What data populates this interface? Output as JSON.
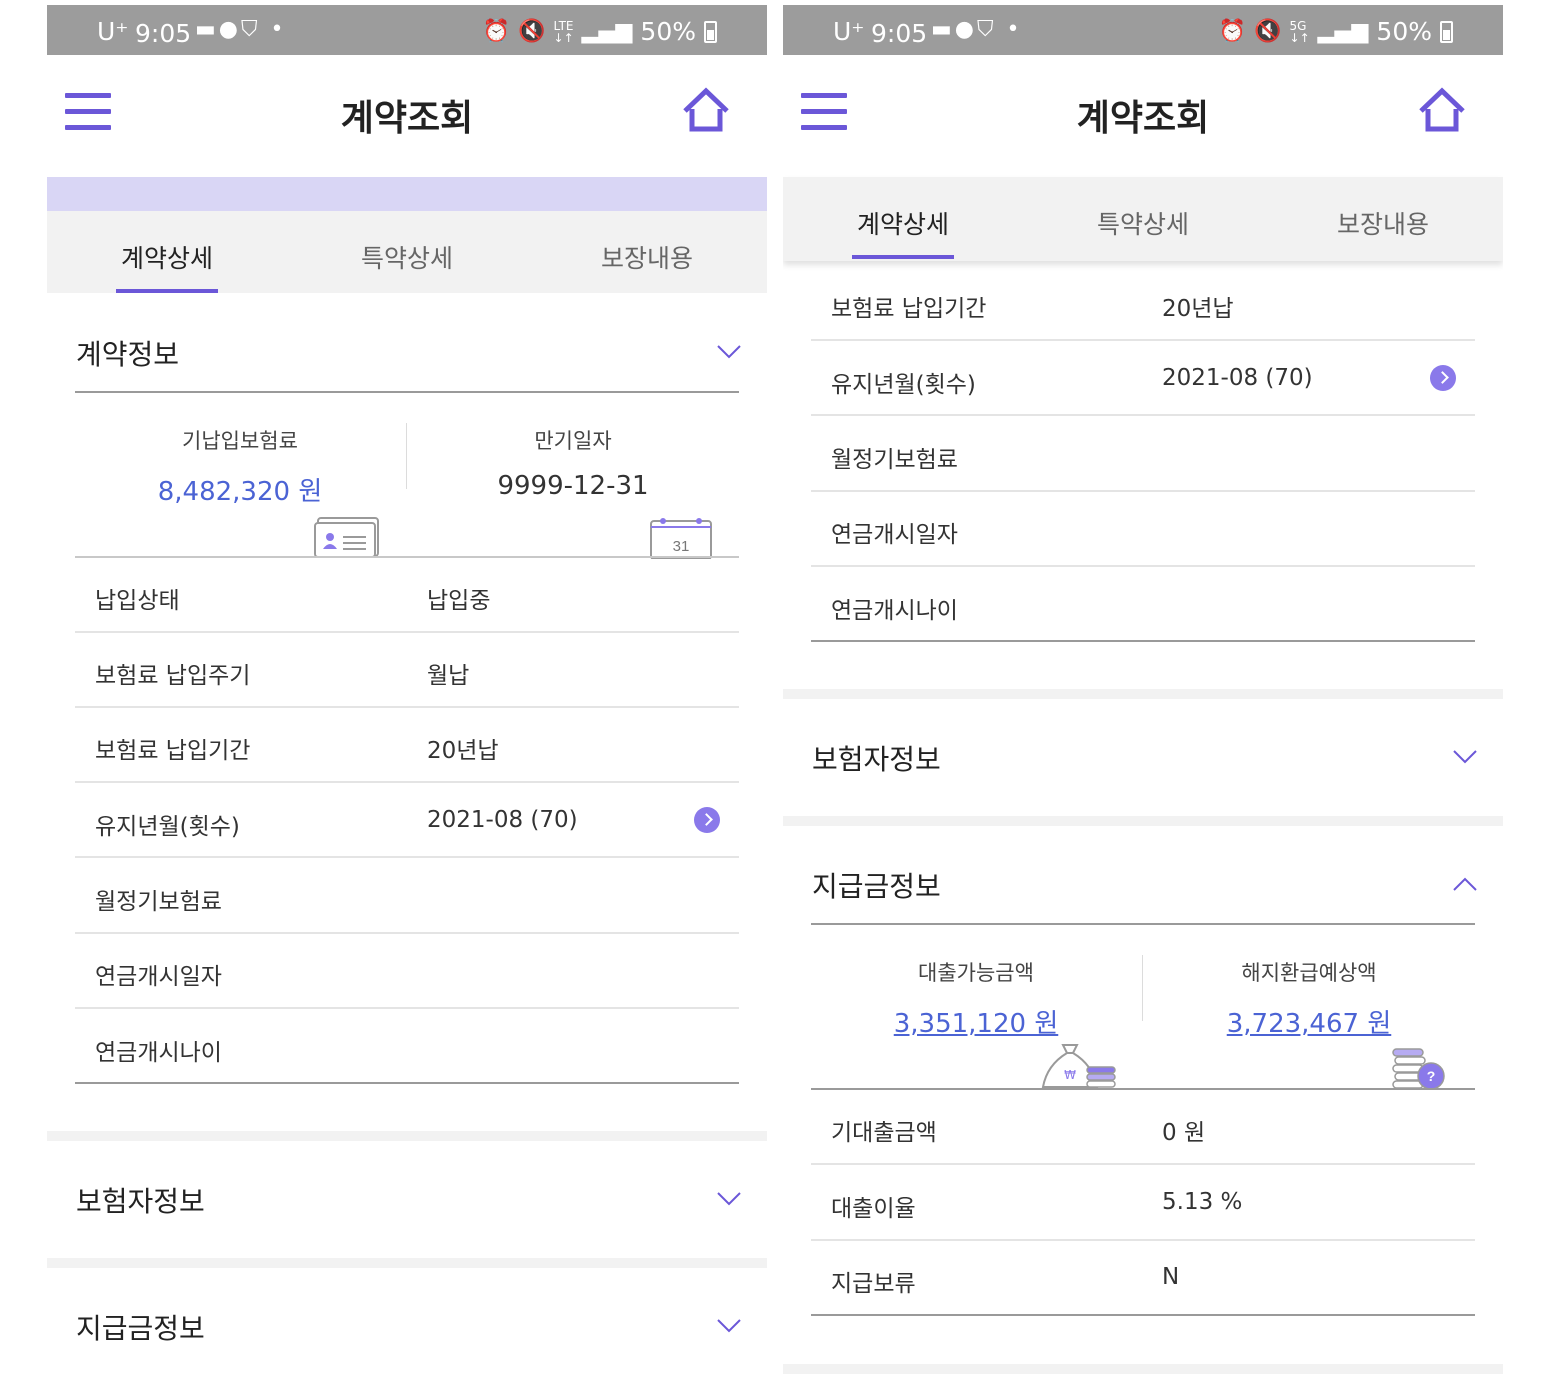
{
  "status_bar": {
    "carrier": "U⁺",
    "time": "9:05",
    "battery": "50%",
    "left_icons": [
      "chat-icon",
      "bubble-icon",
      "shield-icon"
    ],
    "right_icons_left_phone": [
      "alarm-icon",
      "mute-icon",
      "lte-icon",
      "signal-icon"
    ],
    "right_icons_right_phone": [
      "alarm-icon",
      "mute-icon",
      "5g-icon",
      "signal-icon"
    ]
  },
  "header": {
    "title": "계약조회",
    "accent_color": "#6b57d8"
  },
  "tabs": [
    "계약상세",
    "특약상세",
    "보장내용"
  ],
  "active_tab": "계약상세",
  "sections": {
    "contract_info": "계약정보",
    "insured_info": "보험자정보",
    "payment_info": "지급금정보"
  },
  "contract_summary": {
    "paid_premium_label": "기납입보험료",
    "paid_premium_value": "8,482,320 원",
    "maturity_label": "만기일자",
    "maturity_value": "9999-12-31",
    "calendar_day": "31"
  },
  "contract_rows": [
    {
      "label": "납입상태",
      "value": "납입중"
    },
    {
      "label": "보험료 납입주기",
      "value": "월납"
    },
    {
      "label": "보험료 납입기간",
      "value": "20년납"
    },
    {
      "label": "유지년월(횟수)",
      "value": "2021-08 (70)"
    },
    {
      "label": "월정기보험료",
      "value": ""
    },
    {
      "label": "연금개시일자",
      "value": ""
    },
    {
      "label": "연금개시나이",
      "value": ""
    }
  ],
  "payment_summary": {
    "loan_available_label": "대출가능금액",
    "loan_available_value": "3,351,120 원",
    "refund_label": "해지환급예상액",
    "refund_value": "3,723,467 원",
    "won_symbol": "₩",
    "question_symbol": "?"
  },
  "payment_rows": [
    {
      "label": "기대출금액",
      "value": "0 원"
    },
    {
      "label": "대출이율",
      "value": "5.13 %"
    },
    {
      "label": "지급보류",
      "value": "N"
    }
  ]
}
